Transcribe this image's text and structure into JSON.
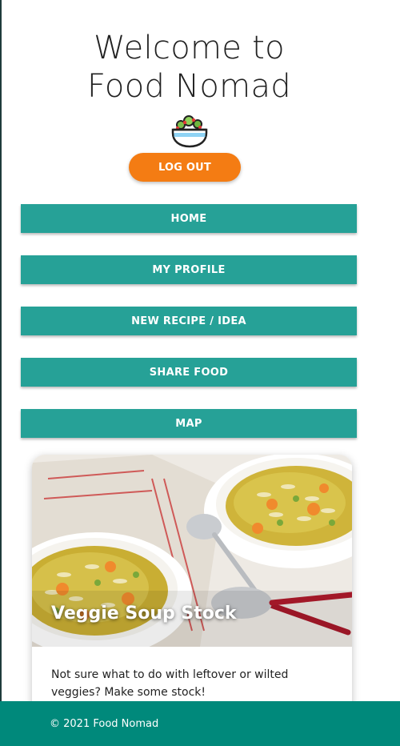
{
  "header": {
    "title_line1": "Welcome to",
    "title_line2": "Food Nomad",
    "logo_icon": "salad-bowl-icon"
  },
  "logout": {
    "label": "LOG OUT"
  },
  "nav": {
    "items": [
      {
        "label": "HOME"
      },
      {
        "label": "MY PROFILE"
      },
      {
        "label": "NEW RECIPE / IDEA"
      },
      {
        "label": "SHARE FOOD"
      },
      {
        "label": "MAP"
      }
    ]
  },
  "card": {
    "title": "Veggie Soup Stock",
    "description": "Not sure what to do with leftover or wilted veggies? Make some stock!"
  },
  "footer": {
    "text": "© 2021 Food Nomad"
  },
  "colors": {
    "accent_orange": "#f47c13",
    "nav_teal": "#26a197",
    "footer_teal": "#00897b"
  }
}
